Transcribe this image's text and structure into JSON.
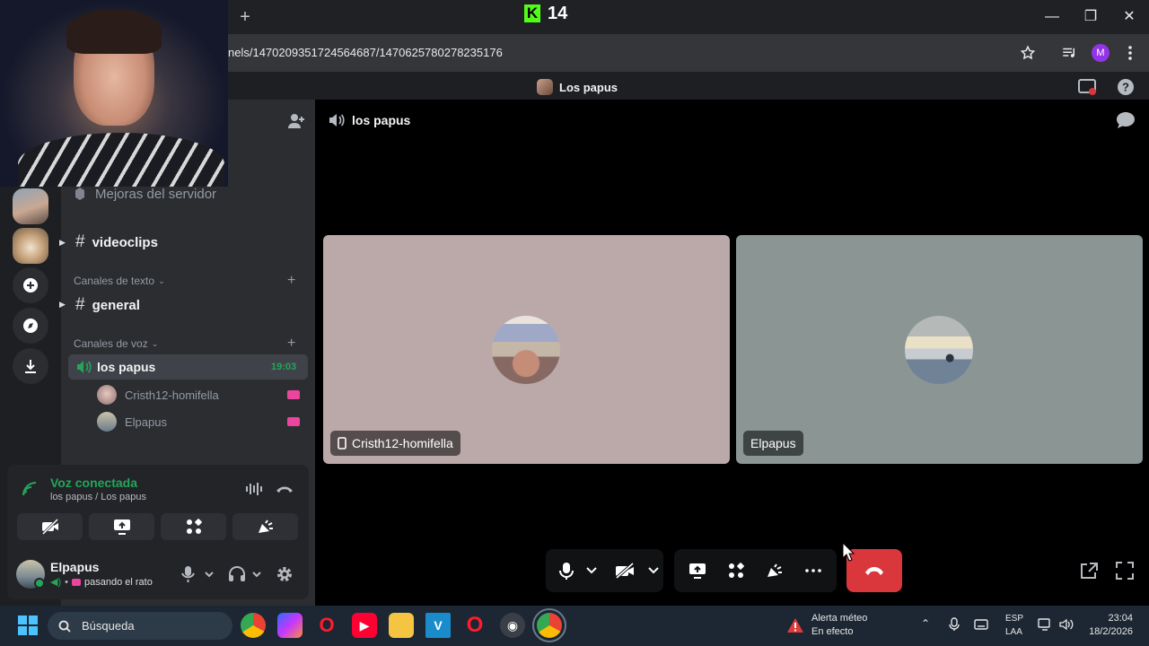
{
  "browser": {
    "new_tab_label": "+",
    "stream_badge": "14",
    "url_text": "nels/1470209351724564687/1470625780278235176",
    "profile_initial": "M",
    "window_minimize": "—",
    "window_restore": "❐",
    "window_close": "✕"
  },
  "discord": {
    "server_title": "Los papus",
    "sidebar": {
      "boost_label": "Mejoras del servidor",
      "channels": {
        "videoclips": "videoclips",
        "general": "general",
        "voice_channel": "los papus",
        "voice_timer": "19:03"
      },
      "categories": {
        "text": "Canales de texto",
        "voice": "Canales de voz"
      },
      "voice_members": [
        {
          "name": "Cristh12-homifella"
        },
        {
          "name": "Elpapus"
        }
      ]
    },
    "voice_panel": {
      "status": "Voz conectada",
      "location": "los papus / Los papus"
    },
    "user_panel": {
      "username": "Elpapus",
      "status": "pasando el rato"
    },
    "stage": {
      "channel_title": "los papus",
      "tiles": [
        {
          "name": "Cristh12-homifella",
          "bg": "#bba9aa"
        },
        {
          "name": "Elpapus",
          "bg": "#8a9594"
        }
      ]
    },
    "colors": {
      "green": "#23a55a",
      "leave_red": "#da373c",
      "accent_pink": "#eb459e"
    }
  },
  "taskbar": {
    "search_placeholder": "Búsqueda",
    "weather_title": "Alerta méteo",
    "weather_sub": "En efecto",
    "lang_top": "ESP",
    "lang_bottom": "LAA",
    "time": "23:04",
    "date": "18/2/2026"
  }
}
